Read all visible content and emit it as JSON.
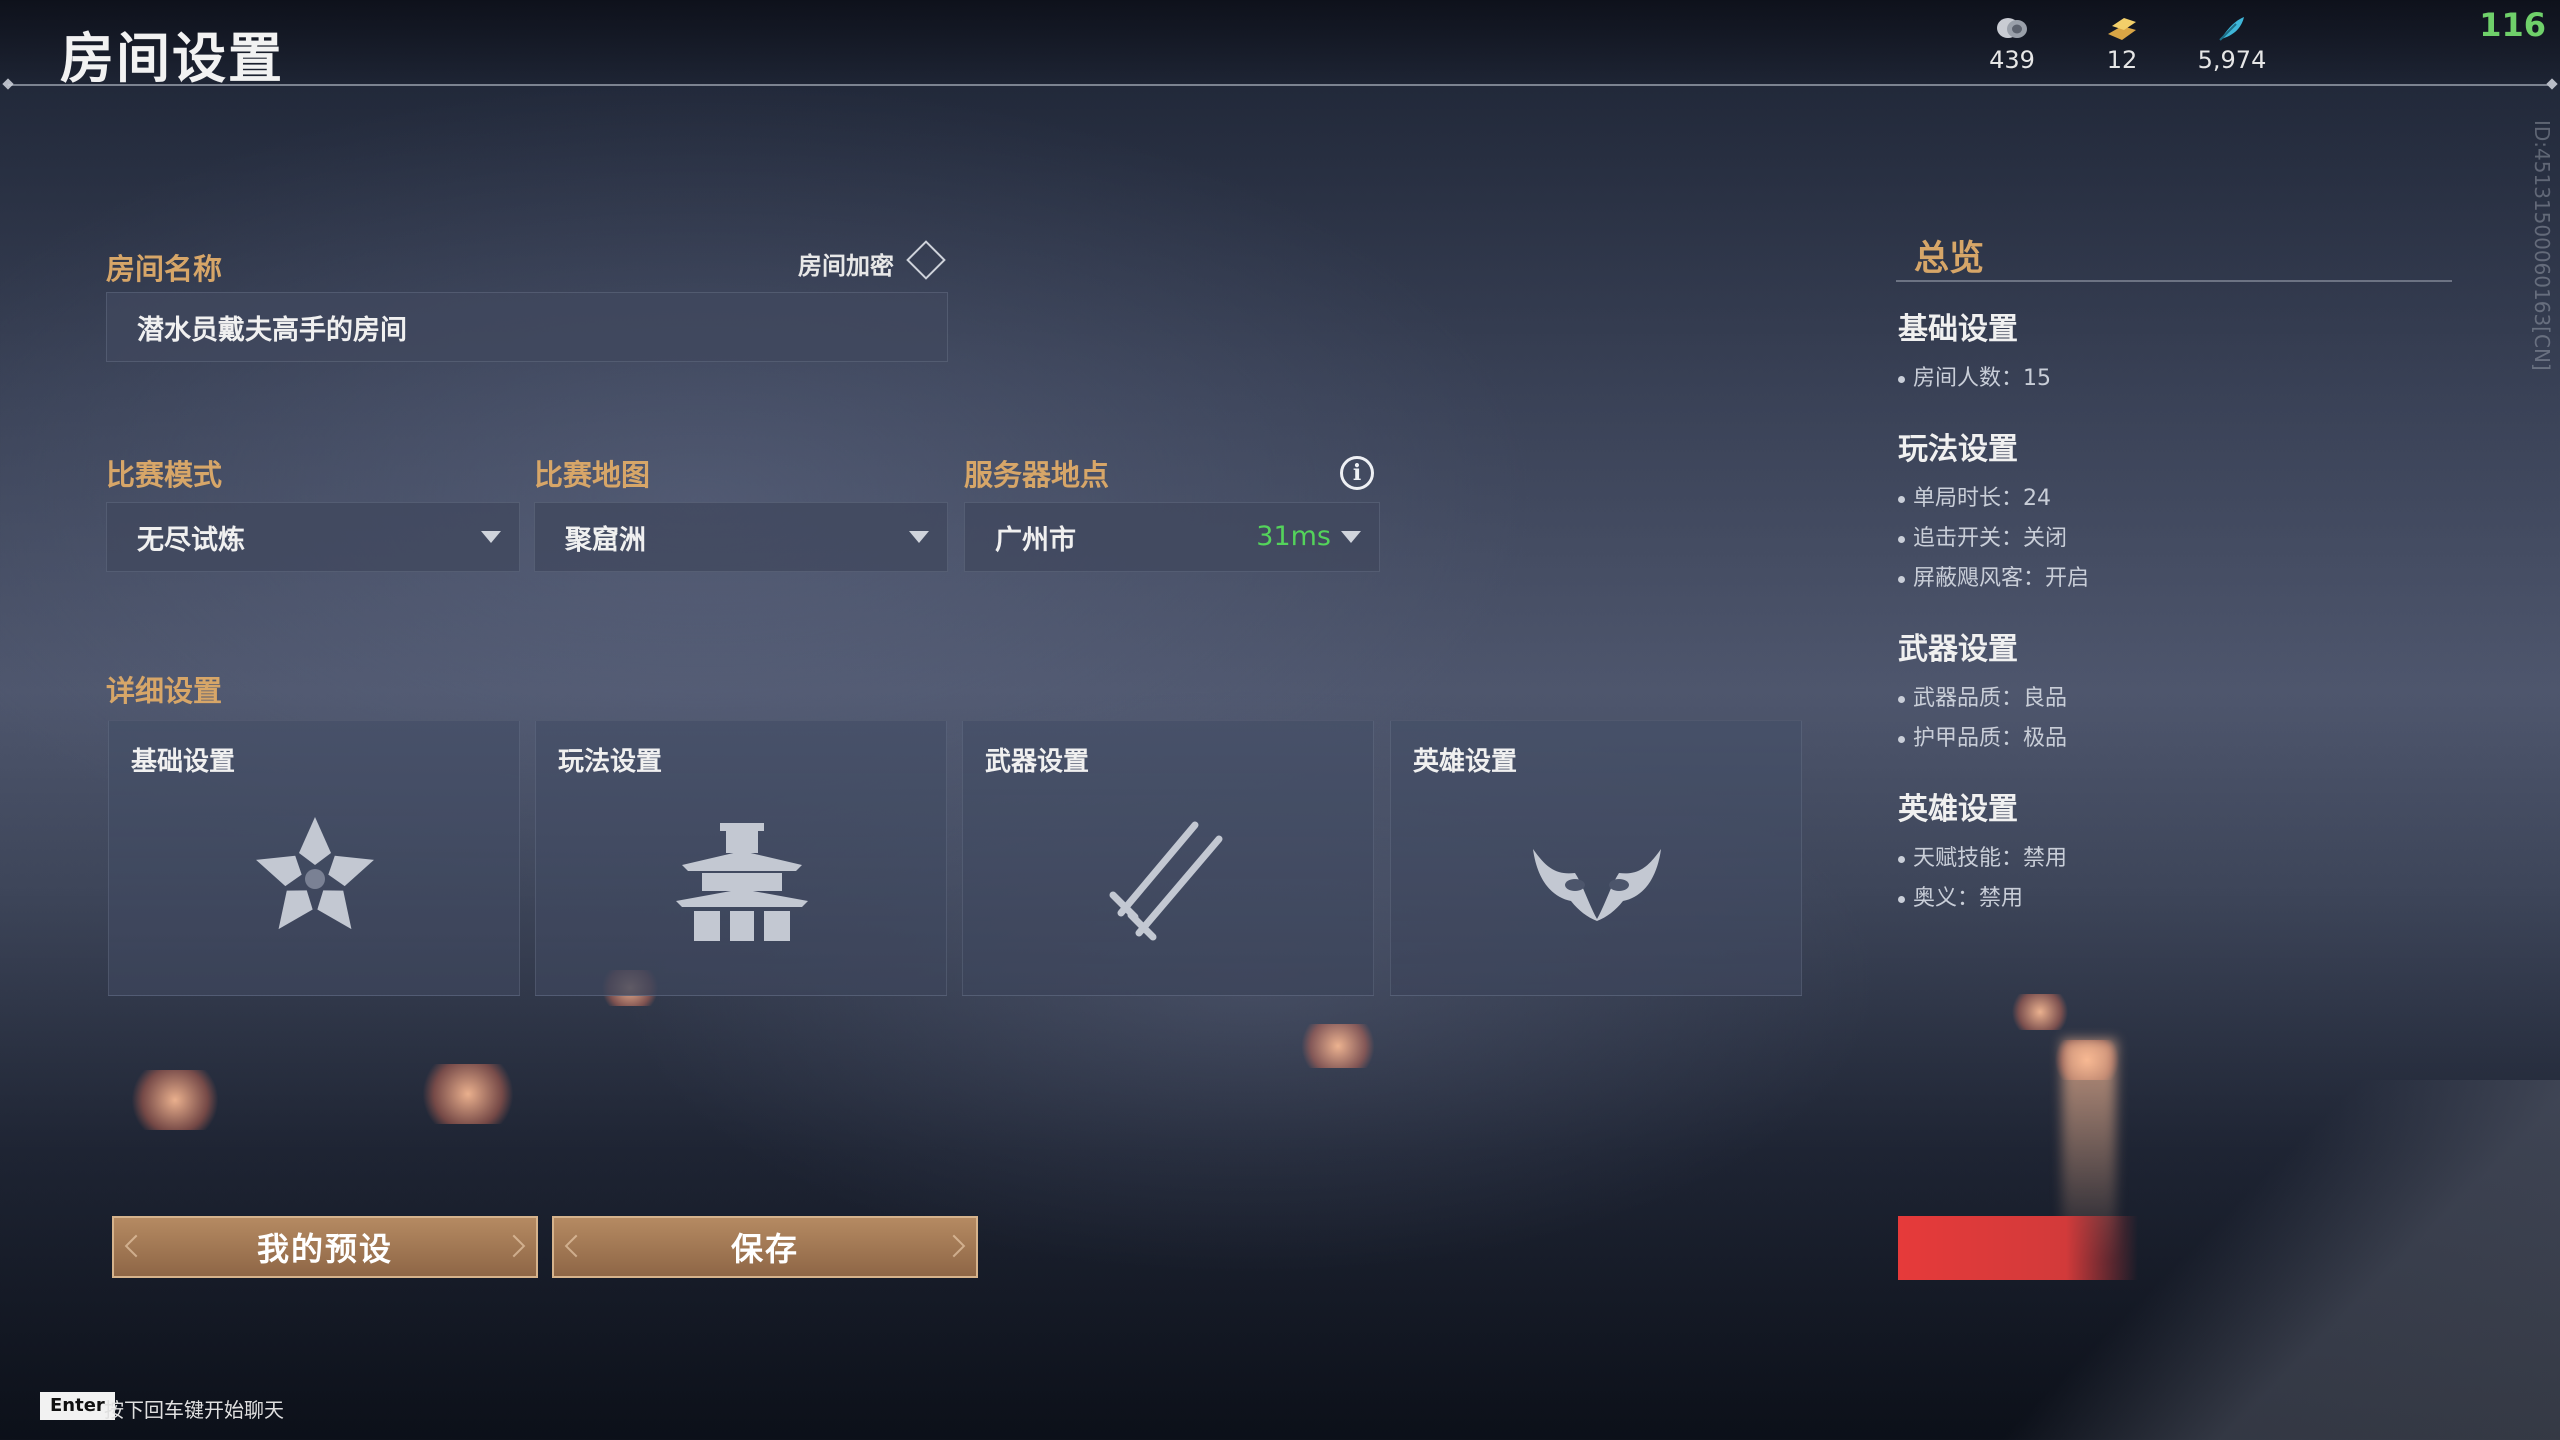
{
  "header": {
    "title": "房间设置",
    "currencies": [
      {
        "icon": "coin-stack-icon",
        "value": "439"
      },
      {
        "icon": "gold-ingot-icon",
        "value": "12"
      },
      {
        "icon": "feather-icon",
        "value": "5,974"
      }
    ],
    "fps": "116",
    "vertical_id": "ID:451315000601​63[CN]"
  },
  "room": {
    "name_label": "房间名称",
    "name_value": "潜水员戴夫高手的房间",
    "encrypt_label": "房间加密"
  },
  "selectors": {
    "mode_label": "比赛模式",
    "mode_value": "无尽试炼",
    "map_label": "比赛地图",
    "map_value": "聚窟洲",
    "server_label": "服务器地点",
    "server_value": "广州市",
    "ping": "31ms"
  },
  "details": {
    "label": "详细设置",
    "cards": [
      {
        "title": "基础设置",
        "icon": "flower-icon"
      },
      {
        "title": "玩法设置",
        "icon": "pagoda-icon"
      },
      {
        "title": "武器设置",
        "icon": "swords-icon"
      },
      {
        "title": "英雄设置",
        "icon": "mask-icon"
      }
    ]
  },
  "buttons": {
    "presets": "我的预设",
    "save": "保存"
  },
  "overview": {
    "title": "总览",
    "sections": [
      {
        "heading": "基础设置",
        "items": [
          "房间人数：15"
        ]
      },
      {
        "heading": "玩法设置",
        "items": [
          "单局时长：24",
          "追击开关：关闭",
          "屏蔽飓风客：开启"
        ]
      },
      {
        "heading": "武器设置",
        "items": [
          "武器品质：良品",
          "护甲品质：极品"
        ]
      },
      {
        "heading": "英雄设置",
        "items": [
          "天赋技能：禁用",
          "奥义：禁用"
        ]
      }
    ]
  },
  "chat": {
    "key": "Enter",
    "hint": "按下回车键开始聊天"
  },
  "colors": {
    "accent": "#d7a668",
    "ping": "#54d35b",
    "fps": "#6fd06a",
    "start_button": "#e63a3a"
  }
}
